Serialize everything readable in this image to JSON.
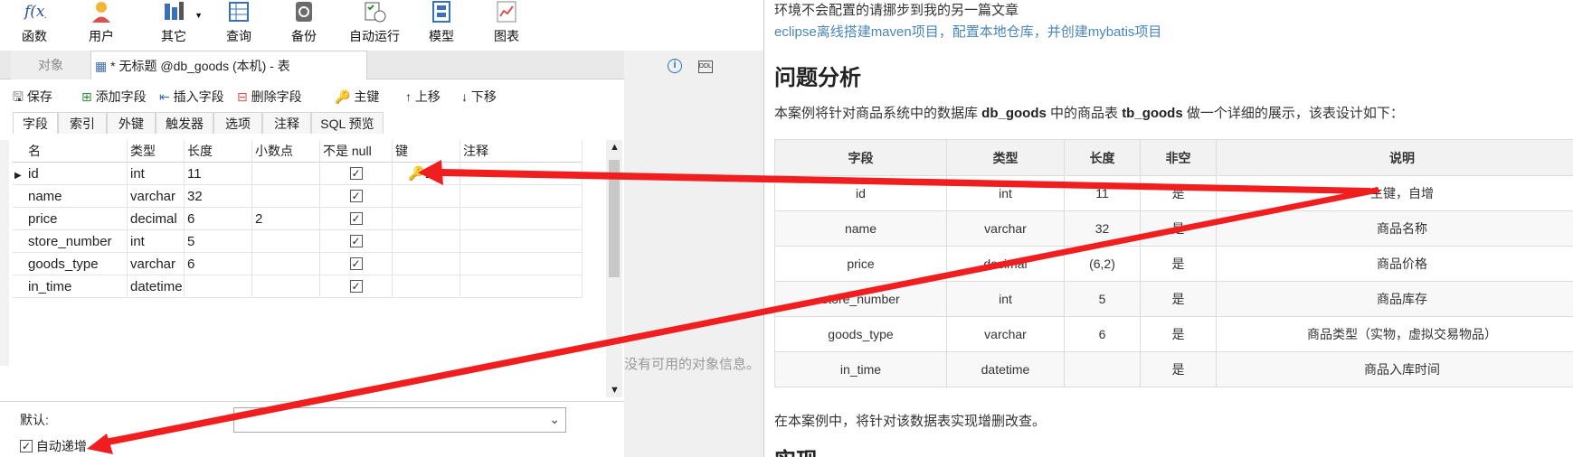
{
  "ribbon": {
    "items": [
      {
        "label": "函数",
        "icon": "function-icon"
      },
      {
        "label": "用户",
        "icon": "user-icon"
      },
      {
        "label": "其它",
        "icon": "tools-icon"
      },
      {
        "label": "查询",
        "icon": "query-icon"
      },
      {
        "label": "备份",
        "icon": "backup-icon"
      },
      {
        "label": "自动运行",
        "icon": "schedule-icon"
      },
      {
        "label": "模型",
        "icon": "model-icon"
      },
      {
        "label": "图表",
        "icon": "chart-icon"
      }
    ]
  },
  "tabs": {
    "objects_label": "对象",
    "active_label": "* 无标题 @db_goods (本机) - 表"
  },
  "toolbar": {
    "save": "保存",
    "add_field": "添加字段",
    "insert_field": "插入字段",
    "delete_field": "删除字段",
    "primary_key": "主键",
    "move_up": "上移",
    "move_down": "下移"
  },
  "subtabs": [
    "字段",
    "索引",
    "外键",
    "触发器",
    "选项",
    "注释",
    "SQL 预览"
  ],
  "grid": {
    "headers": {
      "name": "名",
      "type": "类型",
      "length": "长度",
      "decimals": "小数点",
      "not_null": "不是 null",
      "key": "键",
      "comment": "注释"
    },
    "rows": [
      {
        "name": "id",
        "type": "int",
        "length": "11",
        "decimals": "",
        "not_null": true,
        "key": "1"
      },
      {
        "name": "name",
        "type": "varchar",
        "length": "32",
        "decimals": "",
        "not_null": true,
        "key": ""
      },
      {
        "name": "price",
        "type": "decimal",
        "length": "6",
        "decimals": "2",
        "not_null": true,
        "key": ""
      },
      {
        "name": "store_number",
        "type": "int",
        "length": "5",
        "decimals": "",
        "not_null": true,
        "key": ""
      },
      {
        "name": "goods_type",
        "type": "varchar",
        "length": "6",
        "decimals": "",
        "not_null": true,
        "key": ""
      },
      {
        "name": "in_time",
        "type": "datetime",
        "length": "",
        "decimals": "",
        "not_null": true,
        "key": ""
      }
    ]
  },
  "props": {
    "default_label": "默认:",
    "auto_increment_label": "自动递增",
    "auto_increment_checked": true
  },
  "info_panel": {
    "no_info": "没有可用的对象信息。"
  },
  "article": {
    "line1": "环境不会配置的请挪步到我的另一篇文章",
    "link": "eclipse离线搭建maven项目，配置本地仓库，并创建mybatis项目",
    "heading": "问题分析",
    "intro_prefix": "本案例将针对商品系统中的数据库 ",
    "intro_db": "db_goods",
    "intro_mid": " 中的商品表 ",
    "intro_tbl": "tb_goods",
    "intro_suffix": " 做一个详细的展示，该表设计如下：",
    "table": {
      "headers": [
        "字段",
        "类型",
        "长度",
        "非空",
        "说明"
      ],
      "rows": [
        [
          "id",
          "int",
          "11",
          "是",
          "主键，自增"
        ],
        [
          "name",
          "varchar",
          "32",
          "是",
          "商品名称"
        ],
        [
          "price",
          "decimal",
          "(6,2)",
          "是",
          "商品价格"
        ],
        [
          "store_number",
          "int",
          "5",
          "是",
          "商品库存"
        ],
        [
          "goods_type",
          "varchar",
          "6",
          "是",
          "商品类型（实物，虚拟交易物品）"
        ],
        [
          "in_time",
          "datetime",
          "",
          "是",
          "商品入库时间"
        ]
      ]
    },
    "after": "在本案例中，将针对该数据表实现增删改查。",
    "heading2": "实现"
  },
  "colors": {
    "arrow": "#f01e1e",
    "link": "#4a86b8",
    "key_icon": "#e0a020"
  }
}
